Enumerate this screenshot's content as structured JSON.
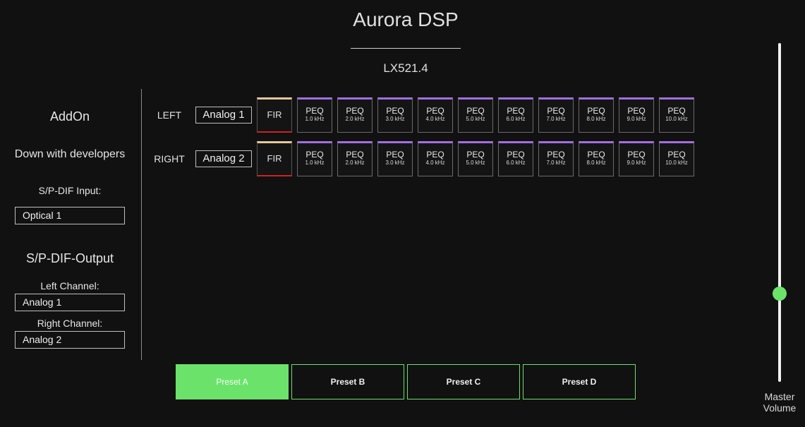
{
  "header": {
    "title": "Aurora DSP",
    "device": "LX521.4"
  },
  "sidebar": {
    "addon_heading": "AddOn",
    "addon_subtitle": "Down with developers",
    "spdif_input_label": "S/P-DIF Input:",
    "spdif_input_value": "Optical 1",
    "spdif_output_heading": "S/P-DIF-Output",
    "left_channel_label": "Left Channel:",
    "left_channel_value": "Analog 1",
    "right_channel_label": "Right Channel:",
    "right_channel_value": "Analog 2"
  },
  "channels": [
    {
      "label": "LEFT",
      "source": "Analog 1",
      "fir": "FIR"
    },
    {
      "label": "RIGHT",
      "source": "Analog 2",
      "fir": "FIR"
    }
  ],
  "peq_label": "PEQ",
  "peq_freqs": [
    "1.0 kHz",
    "2.0 kHz",
    "3.0 kHz",
    "4.0 kHz",
    "5.0 kHz",
    "6.0 kHz",
    "7.0 kHz",
    "8.0 kHz",
    "9.0 kHz",
    "10.0 kHz"
  ],
  "presets": [
    {
      "label": "Preset A",
      "active": true
    },
    {
      "label": "Preset B",
      "active": false
    },
    {
      "label": "Preset C",
      "active": false
    },
    {
      "label": "Preset D",
      "active": false
    }
  ],
  "volume": {
    "label_line1": "Master",
    "label_line2": "Volume",
    "level": 0.26
  },
  "colors": {
    "accent_green": "#6be36b",
    "peq_purple": "#a070e0",
    "fir_gold": "#e8c79a",
    "fir_red": "#cc2222"
  }
}
